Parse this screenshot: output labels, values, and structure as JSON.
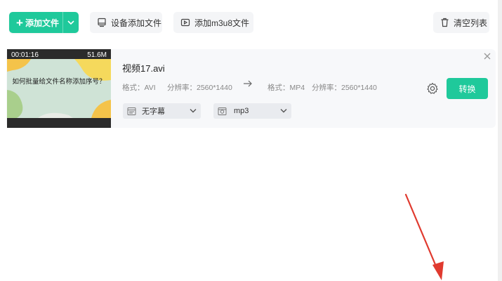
{
  "toolbar": {
    "add_file": "添加文件",
    "device_add": "设备添加文件",
    "add_m3u8": "添加m3u8文件",
    "clear_list": "清空列表"
  },
  "file": {
    "duration": "00:01:16",
    "size": "51.6M",
    "thumb_caption": "如何批量给文件名称添加序号？",
    "name": "视频17.avi",
    "src_format": "格式：AVI",
    "src_resolution": "分辨率：2560*1440",
    "dst_format": "格式：MP4",
    "dst_resolution": "分辨率：2560*1440",
    "subtitle_option": "无字幕",
    "audio_option": "mp3",
    "convert_label": "转换"
  },
  "colors": {
    "accent": "#1fc99b",
    "annotation": "#e03a2f"
  }
}
